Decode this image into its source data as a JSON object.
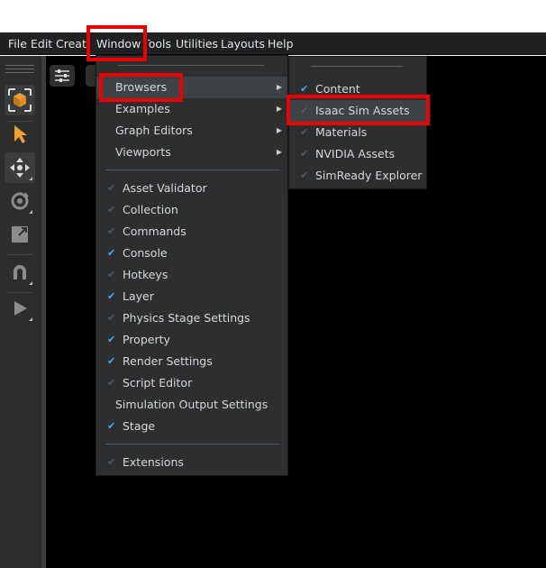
{
  "menubar": {
    "items": [
      "File",
      "Edit",
      "Create",
      "Window",
      "Tools",
      "Utilities",
      "Layouts",
      "Help"
    ]
  },
  "window_menu": {
    "groups": {
      "submenus": [
        {
          "label": "Browsers",
          "has_submenu": true,
          "highlighted": true
        },
        {
          "label": "Examples",
          "has_submenu": true
        },
        {
          "label": "Graph Editors",
          "has_submenu": true
        },
        {
          "label": "Viewports",
          "has_submenu": true
        }
      ],
      "toggles": [
        {
          "label": "Asset Validator",
          "checked": false
        },
        {
          "label": "Collection",
          "checked": false
        },
        {
          "label": "Commands",
          "checked": false
        },
        {
          "label": "Console",
          "checked": true
        },
        {
          "label": "Hotkeys",
          "checked": false
        },
        {
          "label": "Layer",
          "checked": true
        },
        {
          "label": "Physics Stage Settings",
          "checked": false
        },
        {
          "label": "Property",
          "checked": true
        },
        {
          "label": "Render Settings",
          "checked": true
        },
        {
          "label": "Script Editor",
          "checked": false
        },
        {
          "label": "Simulation Output Settings",
          "checked": null
        },
        {
          "label": "Stage",
          "checked": true
        }
      ],
      "footer": [
        {
          "label": "Extensions",
          "checked": false
        }
      ]
    }
  },
  "browsers_submenu": {
    "items": [
      {
        "label": "Content",
        "checked": true
      },
      {
        "label": "Isaac Sim Assets",
        "checked": false,
        "highlighted": true
      },
      {
        "label": "Materials",
        "checked": false
      },
      {
        "label": "NVIDIA Assets",
        "checked": false
      },
      {
        "label": "SimReady Explorer",
        "checked": false
      }
    ]
  },
  "glyphs": {
    "check": "✔",
    "submenu_arrow": "▶"
  },
  "colors": {
    "accent_check": "#4aa8e8",
    "annotation_red": "#ee0000",
    "select_tool_orange": "#f0a030",
    "menubar_bg": "#1f2123",
    "menu_bg": "#2c2e30"
  },
  "toolbar_icons": [
    "select-mode-icon",
    "select-arrow-icon",
    "move-icon",
    "rotate-icon",
    "scale-icon",
    "snap-magnet-icon",
    "play-icon"
  ]
}
